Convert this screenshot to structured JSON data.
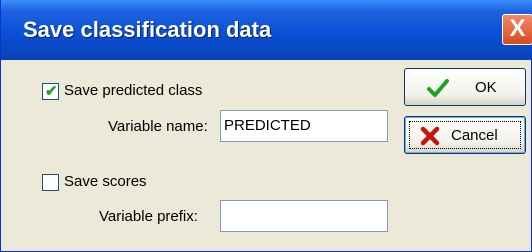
{
  "window": {
    "title": "Save classification data"
  },
  "title_bar": {
    "close_glyph": "X"
  },
  "save_class": {
    "checked": true,
    "label": "Save predicted class"
  },
  "variable_name": {
    "label": "Variable name:",
    "value": "PREDICTED"
  },
  "save_scores": {
    "checked": false,
    "label": "Save scores"
  },
  "variable_prefix": {
    "label": "Variable prefix:",
    "value": ""
  },
  "buttons": {
    "ok_label": "OK",
    "cancel_label": "Cancel"
  },
  "icons": {
    "ok": "checkmark-icon",
    "cancel": "x-mark-icon",
    "checkbox_mark": "check-icon"
  },
  "colors": {
    "title_bar": "#0a4fd6",
    "close_button": "#d94b1f",
    "ok_icon": "#21a121",
    "cancel_icon": "#c8140c"
  }
}
